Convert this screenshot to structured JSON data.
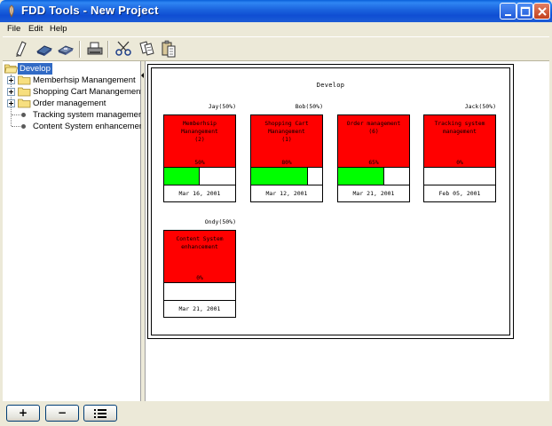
{
  "window": {
    "title": "FDD Tools - New Project",
    "app_icon": "feather-icon"
  },
  "menu": [
    "File",
    "Edit",
    "Help"
  ],
  "toolbar": {
    "buttons": [
      "new-document-icon",
      "open-book-icon",
      "save-icon",
      "print-icon",
      "cut-scissors-icon",
      "copy-icon",
      "paste-icon"
    ]
  },
  "tree": {
    "root": "Develop",
    "items": [
      {
        "label": "Memberhsip Manangement",
        "type": "folder"
      },
      {
        "label": "Shopping Cart Manangement",
        "type": "folder"
      },
      {
        "label": "Order management",
        "type": "folder"
      },
      {
        "label": "Tracking system management",
        "type": "leaf"
      },
      {
        "label": "Content System enhancement",
        "type": "leaf"
      }
    ]
  },
  "diagram": {
    "title": "Develop",
    "cards": [
      {
        "owner": "Jay(50%)",
        "name": "Memberhsip\nManangement\n(2)",
        "percent": "50%",
        "progress": 0.5,
        "date": "Mar 16, 2001"
      },
      {
        "owner": "Bob(50%)",
        "name": "Shopping Cart\nManangement\n(1)",
        "percent": "80%",
        "progress": 0.8,
        "date": "Mar 12, 2001"
      },
      {
        "owner": "",
        "name": "Order management\n(6)",
        "percent": "65%",
        "progress": 0.65,
        "date": "Mar 21, 2001"
      },
      {
        "owner": "Jack(50%)",
        "name": "Tracking system\nmanagement",
        "percent": "0%",
        "progress": 0,
        "date": "Feb 05, 2001"
      },
      {
        "owner": "Ondy(50%)",
        "name": "Content System\nenhancement",
        "percent": "0%",
        "progress": 0,
        "date": "Mar 21, 2001"
      }
    ]
  },
  "bottom_buttons": {
    "add_label": "+",
    "remove_label": "−",
    "list_icon": "list-icon"
  },
  "colors": {
    "card_red": "#ff0000",
    "progress_green": "#00ff00",
    "titlebar_blue": "#0f4ed3",
    "selection_blue": "#316ac5"
  }
}
